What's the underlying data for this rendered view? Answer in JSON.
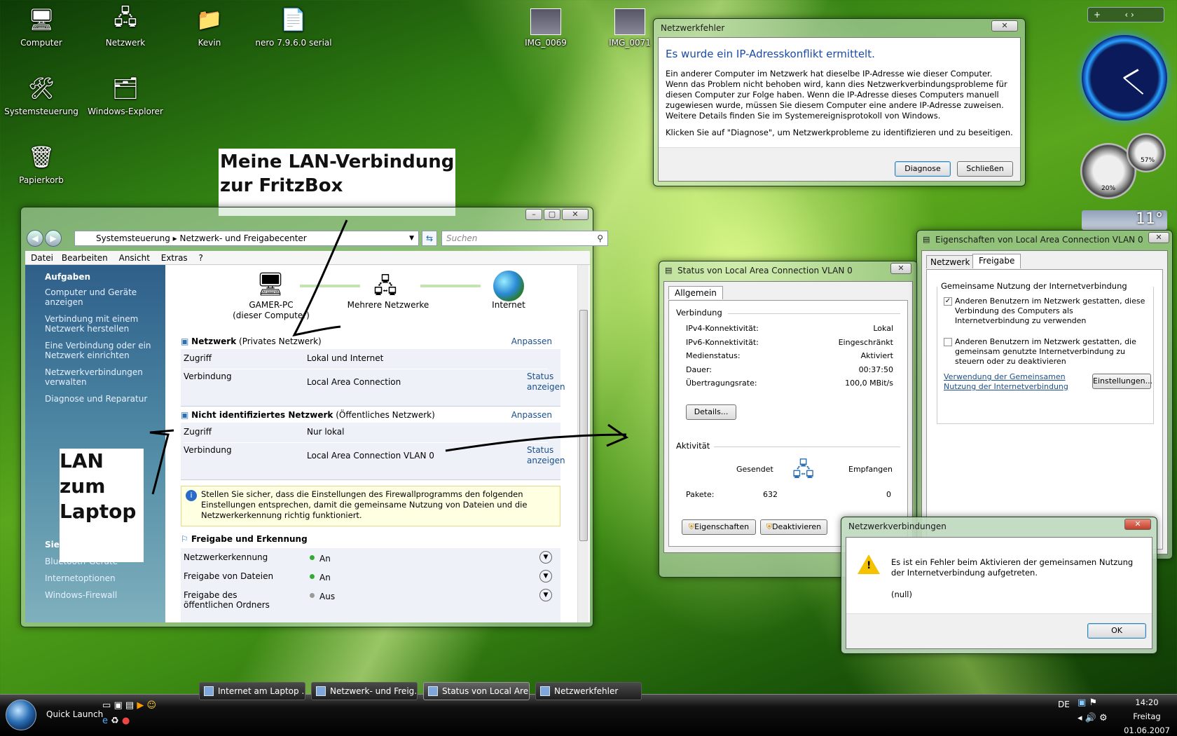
{
  "desktop_icons": [
    {
      "label": "Computer",
      "icon": "computer-icon"
    },
    {
      "label": "Netzwerk",
      "icon": "network-icon"
    },
    {
      "label": "Kevin",
      "icon": "folder-icon"
    },
    {
      "label": "nero 7.9.6.0 serial",
      "icon": "text-file-icon"
    },
    {
      "label": "IMG_0069",
      "icon": "image-icon"
    },
    {
      "label": "IMG_0071",
      "icon": "image-icon"
    },
    {
      "label": "Systemsteuerung",
      "icon": "control-panel-icon"
    },
    {
      "label": "Windows-Explorer",
      "icon": "explorer-icon"
    },
    {
      "label": "Papierkorb",
      "icon": "recycle-bin-icon"
    }
  ],
  "annotations": {
    "fritzbox_line1": "Meine LAN-Verbindung",
    "fritzbox_line2": "zur FritzBox",
    "laptop_line1": "LAN",
    "laptop_line2": "zum",
    "laptop_line3": "Laptop"
  },
  "netzwerkfehler": {
    "title": "Netzwerkfehler",
    "heading": "Es wurde ein IP-Adresskonflikt ermittelt.",
    "body": "Ein anderer Computer im Netzwerk hat dieselbe IP-Adresse wie dieser Computer. Wenn das Problem nicht behoben wird, kann dies Netzwerkverbindungsprobleme für diesen Computer zur Folge haben. Wenn die IP-Adresse dieses Computers manuell zugewiesen wurde, müssen Sie diesem Computer eine andere IP-Adresse zuweisen. Weitere Details finden Sie im Systemereignisprotokoll von Windows.",
    "hint": "Klicken Sie auf \"Diagnose\", um Netzwerkprobleme zu identifizieren und zu beseitigen.",
    "diagnose": "Diagnose",
    "close": "Schließen"
  },
  "nfc": {
    "breadcrumb1": "Systemsteuerung",
    "breadcrumb2": "Netzwerk- und Freigabecenter",
    "search_placeholder": "Suchen",
    "menu": [
      "Datei",
      "Bearbeiten",
      "Ansicht",
      "Extras",
      "?"
    ],
    "tasks_title": "Aufgaben",
    "tasks": [
      "Computer und Geräte anzeigen",
      "Verbindung mit einem Netzwerk herstellen",
      "Eine Verbindung oder ein Netzwerk einrichten",
      "Netzwerkverbindungen verwalten",
      "Diagnose und Reparatur"
    ],
    "see_also_title": "Siehe auch",
    "see_also": [
      "Bluetooth-Geräte",
      "Internetoptionen",
      "Windows-Firewall"
    ],
    "map": {
      "pc": "GAMER-PC",
      "pc_sub": "(dieser Computer)",
      "multi": "Mehrere Netzwerke",
      "internet": "Internet"
    },
    "net1": {
      "name": "Netzwerk",
      "type": "(Privates Netzwerk)",
      "customize": "Anpassen",
      "access_label": "Zugriff",
      "access": "Lokal und Internet",
      "conn_label": "Verbindung",
      "conn": "Local Area Connection",
      "status1": "Status",
      "status2": "anzeigen"
    },
    "net2": {
      "name": "Nicht identifiziertes Netzwerk",
      "type": "(Öffentliches Netzwerk)",
      "customize": "Anpassen",
      "access_label": "Zugriff",
      "access": "Nur lokal",
      "conn_label": "Verbindung",
      "conn": "Local Area Connection VLAN 0",
      "status1": "Status",
      "status2": "anzeigen"
    },
    "firewall_note": "Stellen Sie sicher, dass die Einstellungen des Firewallprogramms den folgenden Einstellungen entsprechen, damit die gemeinsame Nutzung von Dateien und die Netzwerkerkennung richtig funktioniert.",
    "sharing_title": "Freigabe und Erkennung",
    "sharing": [
      {
        "label": "Netzwerkerkennung",
        "value": "An",
        "on": true
      },
      {
        "label": "Freigabe von Dateien",
        "value": "An",
        "on": true
      },
      {
        "label": "Freigabe des öffentlichen Ordners",
        "value": "Aus",
        "on": false
      }
    ]
  },
  "status": {
    "title": "Status von Local Area Connection VLAN 0",
    "tab": "Allgemein",
    "conn_group": "Verbindung",
    "rows": [
      {
        "label": "IPv4-Konnektivität:",
        "value": "Lokal"
      },
      {
        "label": "IPv6-Konnektivität:",
        "value": "Eingeschränkt"
      },
      {
        "label": "Medienstatus:",
        "value": "Aktiviert"
      },
      {
        "label": "Dauer:",
        "value": "00:37:50"
      },
      {
        "label": "Übertragungsrate:",
        "value": "100,0 MBit/s"
      }
    ],
    "details": "Details...",
    "activity_group": "Aktivität",
    "sent": "Gesendet",
    "received": "Empfangen",
    "packets_label": "Pakete:",
    "packets_sent": "632",
    "packets_recv": "0",
    "btn_props": "Eigenschaften",
    "btn_disable": "Deaktivieren"
  },
  "props": {
    "title": "Eigenschaften von Local Area Connection VLAN 0",
    "tabs": [
      "Netzwerk",
      "Freigabe"
    ],
    "group": "Gemeinsame Nutzung der Internetverbindung",
    "cb1": "Anderen Benutzern im Netzwerk gestatten, diese Verbindung des Computers als Internetverbindung zu verwenden",
    "cb2": "Anderen Benutzern im Netzwerk gestatten, die gemeinsam genutzte Internetverbindung zu steuern oder zu deaktivieren",
    "link": "Verwendung der Gemeinsamen Nutzung der Internetverbindung",
    "settings": "Einstellungen..."
  },
  "nvdialog": {
    "title": "Netzwerkverbindungen",
    "message": "Es ist ein Fehler beim Aktivieren der gemeinsamen Nutzung der Internetverbindung aufgetreten.",
    "detail": "(null)",
    "ok": "OK"
  },
  "gadgets": {
    "temperature": "11°",
    "cpu": "20%",
    "mem": "57%"
  },
  "taskbar": {
    "quick_launch": "Quick Launch",
    "buttons": [
      "Internet am Laptop ...",
      "Netzwerk- und Freig...",
      "Status von Local Are...",
      "Netzwerkfehler"
    ],
    "lang": "DE",
    "time": "14:20",
    "day": "Freitag",
    "date": "01.06.2007"
  }
}
